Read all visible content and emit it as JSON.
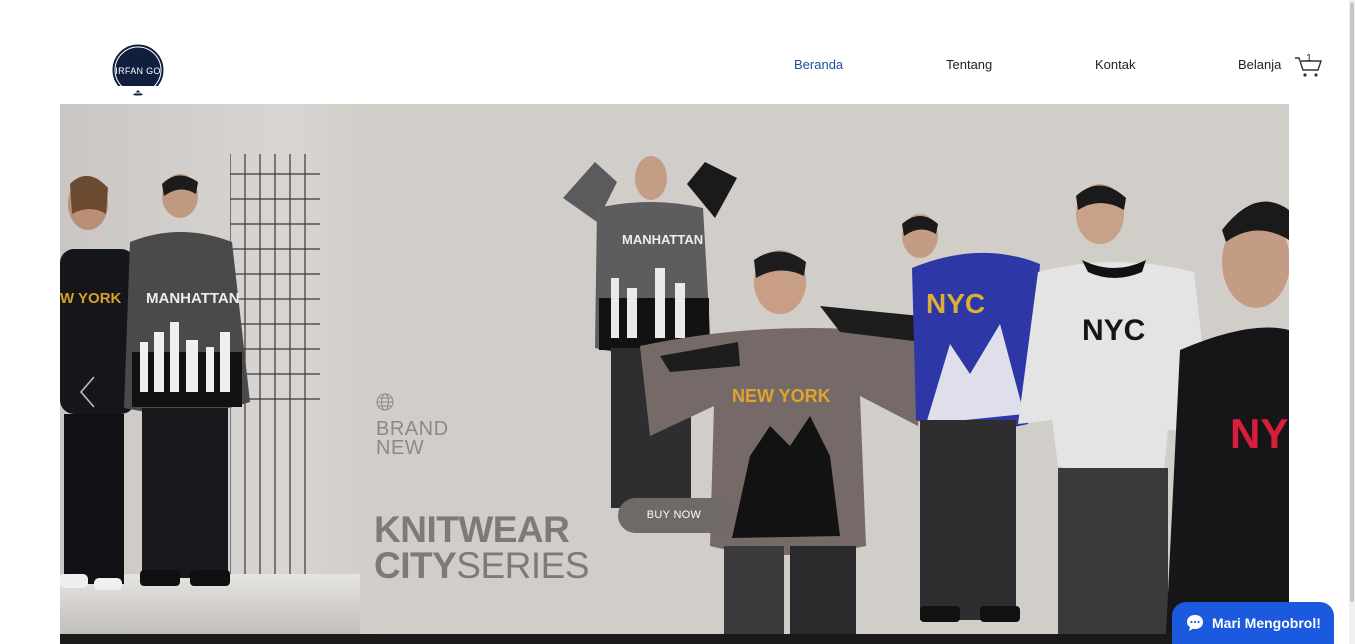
{
  "header": {
    "logo_text": "IRFAN GO",
    "nav": [
      {
        "label": "Beranda",
        "active": true
      },
      {
        "label": "Tentang",
        "active": false
      },
      {
        "label": "Kontak",
        "active": false
      },
      {
        "label": "Belanja",
        "active": false
      }
    ],
    "cart_count": "1"
  },
  "hero": {
    "brand_line1": "BRAND",
    "brand_line2": "NEW",
    "title_bold1": "KNITWEAR",
    "title_bold2": "CITY",
    "title_thin2": "SERIES",
    "button_label": "BUY NOW",
    "sweater_texts": {
      "left_woman": "W YORK",
      "left_man": "MANHATTAN",
      "raised": "MANHATTAN",
      "center": "NEW YORK",
      "blue": "NYC",
      "grey": "NYC",
      "black": "NY"
    }
  },
  "chat": {
    "label": "Mari Mengobrol!"
  },
  "colors": {
    "nav_active": "#1d4f9c",
    "chat_bg": "#1b5adf",
    "button_bg": "#6f6967",
    "hero_bg": "#d1cdc9"
  },
  "icons": [
    "logo-badge",
    "cart-icon",
    "chevron-left-icon",
    "globe-icon",
    "chat-bubble-icon"
  ]
}
